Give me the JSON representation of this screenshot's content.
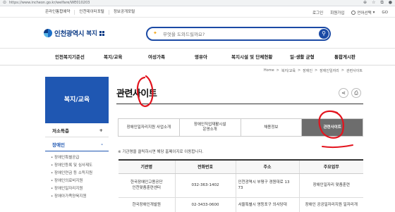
{
  "browser": {
    "url": "https://www.incheon.go.kr/welfare/WE010203"
  },
  "topbar": {
    "links": [
      "온라인통합예약",
      "인천데이터포털",
      "정보공개포털"
    ],
    "login": "로그인",
    "signup": "회원가입",
    "language": "언어선택",
    "go": "GO"
  },
  "header": {
    "logo_name": "인천광역시",
    "logo_sub": "복지",
    "search_placeholder": "무엇을 도와드릴까요?"
  },
  "gnb": [
    "인천복지기준선",
    "복지/교육",
    "여성가족",
    "영유아",
    "복지시설 및 단체현황",
    "일·생활 균형",
    "통합게시판"
  ],
  "breadcrumb": [
    "Home",
    ">",
    "복지/교육",
    ">",
    "장애인",
    ">",
    "장애인일자리",
    ">",
    "관련사이트"
  ],
  "sidebar": {
    "title": "복지/교육",
    "sections": [
      {
        "label": "저소득층",
        "toggle": "+"
      },
      {
        "label": "장애인",
        "toggle": "-"
      }
    ],
    "subitems": [
      "장애인특별공급",
      "장애인등록 및 심사제도",
      "장애인연금 등 소득지원",
      "장애인의료비지원",
      "장애인일자리지원",
      "장애아가족양육지원"
    ]
  },
  "main": {
    "title": "관련사이트",
    "tabs": [
      "장애인일자리지원 사업소개",
      "장애인직업재활시설\n운영소개",
      "채용정보",
      "관련사이트"
    ],
    "note": "※ 기관명을 클릭하시면 해당 홈페이지로 이동합니다.",
    "table": {
      "headers": [
        "기관명",
        "전화번호",
        "주소",
        "주요업무"
      ],
      "rows": [
        [
          "한국장애인고용공단\n인천맞춤훈련센터",
          "032-363-1402",
          "인천광역시 부평구 경원대로 13\n73",
          "장애인일자리 맞춤훈련"
        ],
        [
          "한국장애인개발원",
          "02-3433-0600",
          "서울특별시 영등포구 의사당대",
          "장애인 공공일자리지원 일자리개"
        ]
      ]
    }
  },
  "colors": {
    "primary": "#1f57b2",
    "header_blue": "#1b4aa5",
    "active_tab": "#6d6d6d",
    "annotation": "#e3141e"
  }
}
